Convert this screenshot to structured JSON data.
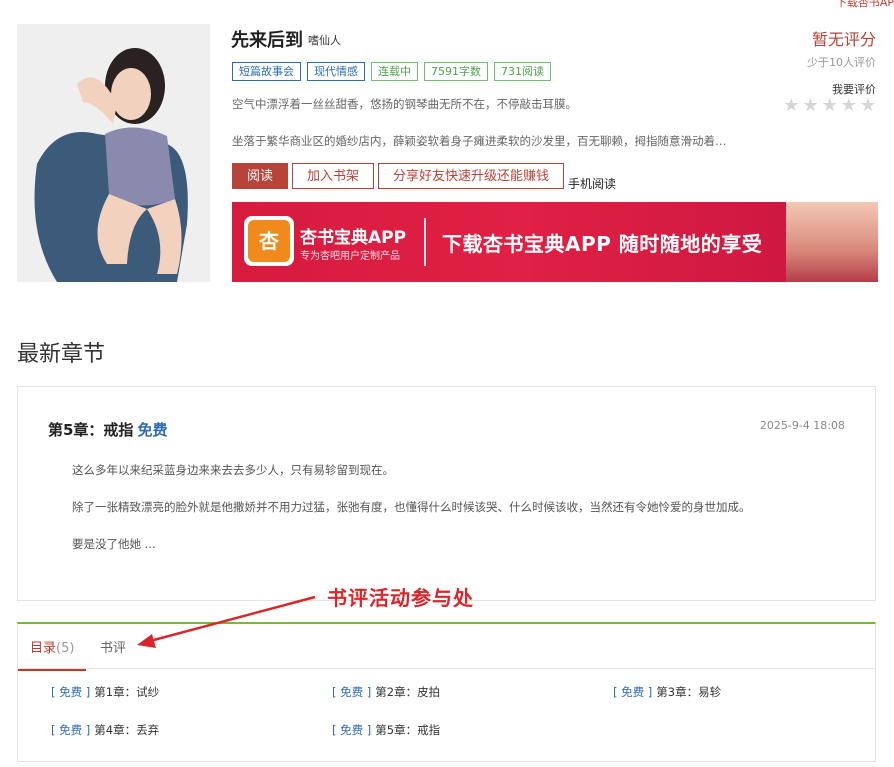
{
  "top_link": "下载杏书AP",
  "book": {
    "title": "先来后到",
    "author": "嗜仙人",
    "tags": [
      {
        "label": "短篇故事会",
        "style": "blue"
      },
      {
        "label": "现代情感",
        "style": "blue"
      },
      {
        "label": "连载中",
        "style": "green"
      },
      {
        "label": "7591字数",
        "style": "green"
      },
      {
        "label": "731阅读",
        "style": "green"
      }
    ],
    "desc1": "空气中漂浮着一丝丝甜香，悠扬的钢琴曲无所不在，不停敲击耳膜。",
    "desc2": "坐落于繁华商业区的婚纱店内，薛颖姿软着身子瘫进柔软的沙发里，百无聊赖，拇指随意滑动着…"
  },
  "buttons": {
    "read": "阅读",
    "add_shelf": "加入书架",
    "share": "分享好友快速升级还能赚钱",
    "mobile": "手机阅读"
  },
  "banner": {
    "logo_char": "杏",
    "app_name": "杏书宝典APP",
    "app_sub": "专为杏吧用户定制产品",
    "slogan": "下载杏书宝典APP 随时随地的享受"
  },
  "rating": {
    "score": "暂无评分",
    "count": "少于10人评价",
    "rate_label": "我要评价",
    "stars": 5
  },
  "latest": {
    "section_title": "最新章节",
    "chapter_title": "第5章：戒指",
    "free": "免费",
    "time": "2025-9-4 18:08",
    "paragraphs": [
      "这么多年以来纪采蓝身边来来去去多少人，只有易轸留到现在。",
      "除了一张精致漂亮的脸外就是他撒娇并不用力过猛，张弛有度，也懂得什么时候该哭、什么时候该收，当然还有令她怜爱的身世加成。",
      "要是没了他她 ..."
    ]
  },
  "annotation": "书评活动参与处",
  "toc": {
    "tab_catalog": "目录",
    "tab_count": "(5)",
    "tab_review": "书评",
    "items": [
      {
        "free": "[ 免费 ]",
        "title": "第1章：试纱"
      },
      {
        "free": "[ 免费 ]",
        "title": "第2章：皮拍"
      },
      {
        "free": "[ 免费 ]",
        "title": "第3章：易轸"
      },
      {
        "free": "[ 免费 ]",
        "title": "第4章：丢弃"
      },
      {
        "free": "[ 免费 ]",
        "title": "第5章：戒指"
      }
    ]
  },
  "colors": {
    "accent": "#b84338",
    "link_blue": "#2d6cb5",
    "tag_green": "#4ea24e",
    "annotation_red": "#d9262a"
  }
}
